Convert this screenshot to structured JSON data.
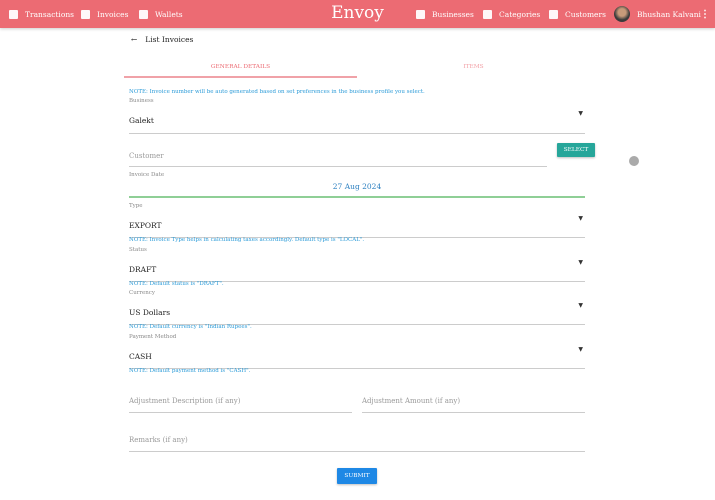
{
  "nav": {
    "left": [
      {
        "label": "Transactions",
        "icon": "list-icon"
      },
      {
        "label": "Invoices",
        "icon": "invoices-icon"
      },
      {
        "label": "Wallets",
        "icon": "wallet-icon"
      }
    ],
    "brand": "Envoy",
    "right": [
      {
        "label": "Businesses",
        "icon": "building-icon"
      },
      {
        "label": "Categories",
        "icon": "grid-icon"
      },
      {
        "label": "Customers",
        "icon": "contact-icon"
      }
    ],
    "user": "Bhushan Kalvani"
  },
  "back_label": "List Invoices",
  "tabs": [
    "GENERAL DETAILS",
    "ITEMS"
  ],
  "form": {
    "note_invoice": "NOTE: Invoice number will be auto generated based on set preferences in the business profile you select.",
    "business_label": "Business",
    "business": "Galekt",
    "customer_placeholder": "Customer",
    "select_button": "SELECT",
    "date_label": "Invoice Date",
    "date": "27 Aug 2024",
    "type_label": "Type",
    "type": "EXPORT",
    "note_type": "NOTE: Invoice Type helps in calculating taxes accordingly. Default type is \"LOCAL\".",
    "status_label": "Status",
    "status": "DRAFT",
    "note_status": "NOTE: Default status is \"DRAFT\".",
    "currency_label": "Currency",
    "currency": "US Dollars",
    "note_currency": "NOTE: Default currency is \"Indian Rupees\".",
    "payment_label": "Payment Method",
    "payment": "CASH",
    "note_payment": "NOTE: Default payment method is \"CASH\".",
    "adj_desc_placeholder": "Adjustment Description (if any)",
    "adj_amount_placeholder": "Adjustment Amount (if any)",
    "remarks_placeholder": "Remarks (if any)",
    "submit": "SUBMIT"
  },
  "colors": {
    "primary": "#ec6b73",
    "accent": "#26a69a",
    "note": "#2b9bd8"
  }
}
